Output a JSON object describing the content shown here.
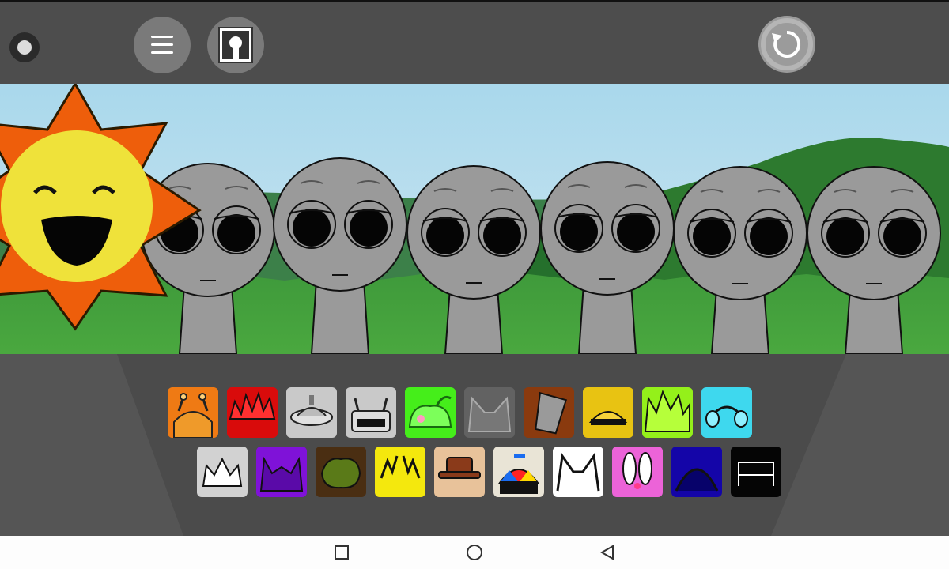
{
  "toolbar": {
    "record_icon": "record-dot-icon",
    "menu_icon": "hamburger-menu-icon",
    "portrait_icon": "character-portrait-icon",
    "reset_icon": "reset-arrow-icon"
  },
  "stage": {
    "sun_icon": "smiling-sun-icon",
    "characters": [
      {
        "slot": 1,
        "state": "empty"
      },
      {
        "slot": 2,
        "state": "empty"
      },
      {
        "slot": 3,
        "state": "empty"
      },
      {
        "slot": 4,
        "state": "empty"
      },
      {
        "slot": 5,
        "state": "empty"
      },
      {
        "slot": 6,
        "state": "empty"
      }
    ]
  },
  "sound_icons": {
    "row1": [
      {
        "name": "orange-antenna-ears-icon",
        "color": "#ef7a14"
      },
      {
        "name": "red-spiky-hair-icon",
        "color": "#d90b0b"
      },
      {
        "name": "grey-lid-hat-icon",
        "color": "#c9c9c9"
      },
      {
        "name": "robot-helmet-icon",
        "color": "#c9c9c9"
      },
      {
        "name": "green-slime-icon",
        "color": "#45ee1a"
      },
      {
        "name": "grey-cat-ears-icon",
        "color": "#626262"
      },
      {
        "name": "bucket-hat-icon",
        "color": "#8a3a0e"
      },
      {
        "name": "yellow-cap-icon",
        "color": "#e8c312"
      },
      {
        "name": "lime-spiky-hair-icon",
        "color": "#94f01a"
      },
      {
        "name": "cyan-headphones-icon",
        "color": "#3ed8ee"
      }
    ],
    "row2": [
      {
        "name": "white-crown-icon",
        "color": "#d2d2d2"
      },
      {
        "name": "purple-horns-icon",
        "color": "#7f12d8"
      },
      {
        "name": "olive-bush-hair-icon",
        "color": "#4a2e12"
      },
      {
        "name": "yellow-lightning-icon",
        "color": "#f4e80d"
      },
      {
        "name": "brown-fedora-icon",
        "color": "#e8c29a"
      },
      {
        "name": "propeller-cap-icon",
        "color": "#e9e4d6"
      },
      {
        "name": "white-cat-ears-icon",
        "color": "#ffffff"
      },
      {
        "name": "pink-bunny-ears-icon",
        "color": "#ec63d8"
      },
      {
        "name": "navy-dome-icon",
        "color": "#1405a8"
      },
      {
        "name": "black-bench-icon",
        "color": "#050505"
      }
    ]
  },
  "system_nav": {
    "recents_icon": "square-recents-icon",
    "home_icon": "circle-home-icon",
    "back_icon": "triangle-back-icon"
  }
}
